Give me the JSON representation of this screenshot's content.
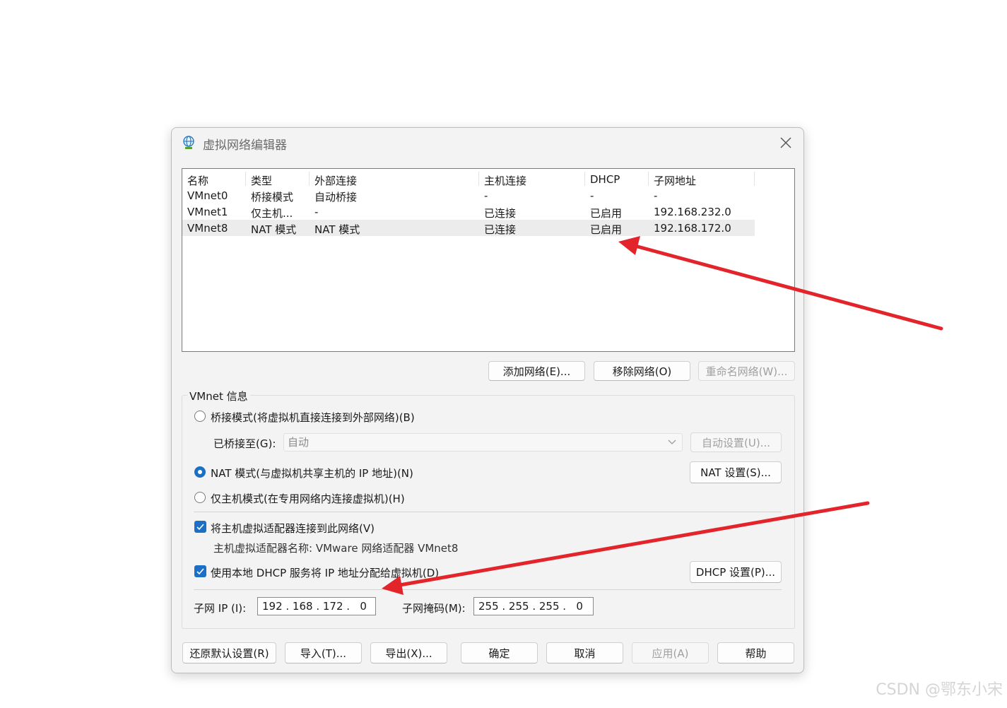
{
  "window": {
    "title": "虚拟网络编辑器",
    "icon": "globe-network-icon"
  },
  "table": {
    "columns": [
      "名称",
      "类型",
      "外部连接",
      "主机连接",
      "DHCP",
      "子网地址"
    ],
    "rows": [
      [
        "VMnet0",
        "桥接模式",
        "自动桥接",
        "-",
        "-",
        "-"
      ],
      [
        "VMnet1",
        "仅主机...",
        "-",
        "已连接",
        "已启用",
        "192.168.232.0"
      ],
      [
        "VMnet8",
        "NAT 模式",
        "NAT 模式",
        "已连接",
        "已启用",
        "192.168.172.0"
      ]
    ],
    "selected_row": "VMnet8"
  },
  "network_buttons": {
    "add": "添加网络(E)...",
    "remove": "移除网络(O)",
    "rename": "重命名网络(W)..."
  },
  "vmnet_info": {
    "title": "VMnet 信息",
    "bridged_label": "桥接模式(将虚拟机直接连接到外部网络)(B)",
    "bridged_to_label": "已桥接至(G):",
    "bridged_to_value": "自动",
    "auto_settings": "自动设置(U)...",
    "nat_label": "NAT 模式(与虚拟机共享主机的 IP 地址)(N)",
    "nat_settings": "NAT 设置(S)...",
    "hostonly_label": "仅主机模式(在专用网络内连接虚拟机)(H)",
    "selected_mode": "NAT",
    "connect_adapter_label": "将主机虚拟适配器连接到此网络(V)",
    "connect_adapter_checked": true,
    "adapter_name_text": "主机虚拟适配器名称: VMware 网络适配器 VMnet8",
    "dhcp_label": "使用本地 DHCP 服务将 IP 地址分配给虚拟机(D)",
    "dhcp_checked": true,
    "dhcp_settings": "DHCP 设置(P)...",
    "subnet_ip_label": "子网 IP (I):",
    "subnet_ip_value": "192 . 168 . 172 .   0",
    "subnet_mask_label": "子网掩码(M):",
    "subnet_mask_value": "255 . 255 . 255 .   0"
  },
  "footer_buttons": {
    "restore": "还原默认设置(R)",
    "import": "导入(T)...",
    "export": "导出(X)...",
    "ok": "确定",
    "cancel": "取消",
    "apply": "应用(A)",
    "help": "帮助"
  },
  "annotation": {
    "arrow_color": "#e3242b"
  },
  "watermark": "CSDN @鄂东小宋",
  "colors": {
    "accent": "#1b6fc4",
    "dialog_bg": "#f3f3f3"
  }
}
